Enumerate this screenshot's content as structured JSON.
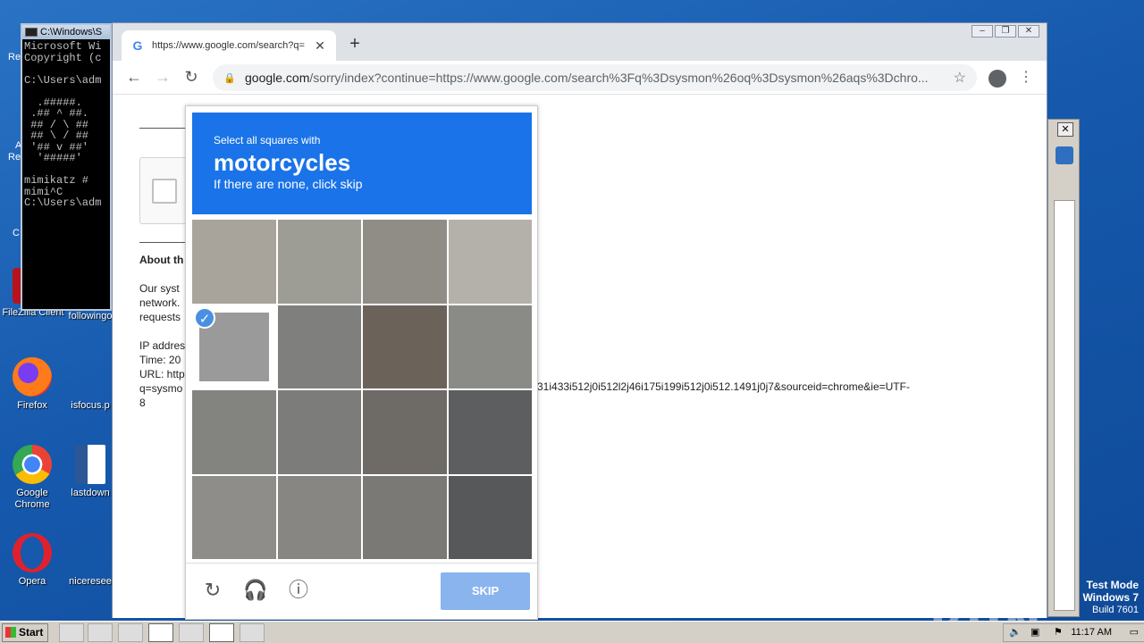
{
  "desktop": {
    "icons": [
      {
        "label": "FileZilla Client"
      },
      {
        "label": "followingo"
      },
      {
        "label": "Firefox"
      },
      {
        "label": "isfocus.p"
      },
      {
        "label": "Google Chrome"
      },
      {
        "label": "lastdown"
      },
      {
        "label": "Opera"
      },
      {
        "label": "niceresee"
      }
    ],
    "fragments": [
      "Re",
      "A",
      "Re",
      "C"
    ]
  },
  "cmd": {
    "title": "C:\\Windows\\S",
    "lines": "Microsoft Wi\nCopyright (c\n\nC:\\Users\\adm\n\n  .#####.\n .## ^ ##.\n ## / \\ ##\n ## \\ / ##\n '## v ##'\n  '#####'\n\nmimikatz #\nmimi^C\nC:\\Users\\adm"
  },
  "browser": {
    "tab_title": "https://www.google.com/search?q=",
    "url_host": "google.com",
    "url_rest": "/sorry/index?continue=https://www.google.com/search%3Fq%3Dsysmon%26oq%3Dsysmon%26aqs%3Dchro..."
  },
  "page": {
    "about_heading": "About th",
    "para1": [
      "Our syst",
      "network.",
      "requests"
    ],
    "ip_lines": [
      "IP addres",
      "Time: 20",
      "URL: http",
      "q=sysmo"
    ],
    "url_tail": "31i433i512j0i512l2j46i175i199i512j0i512.1491j0j7&sourceid=chrome&ie=UTF-",
    "url_tail2": "8"
  },
  "captcha": {
    "instruction": "Select all squares with",
    "target": "motorcycles",
    "hint": "If there are none, click skip",
    "skip_label": "SKIP",
    "selected_tile": 4
  },
  "watermark": "ANY RUN",
  "testmode": {
    "line1": "Test Mode",
    "line2": "Windows 7",
    "line3": "Build 7601"
  },
  "taskbar": {
    "start": "Start",
    "clock": "11:17 AM"
  },
  "colors": {
    "captcha_blue": "#1a73e8",
    "skip_disabled": "#8ab4ee",
    "desktop": "#1659ad"
  }
}
